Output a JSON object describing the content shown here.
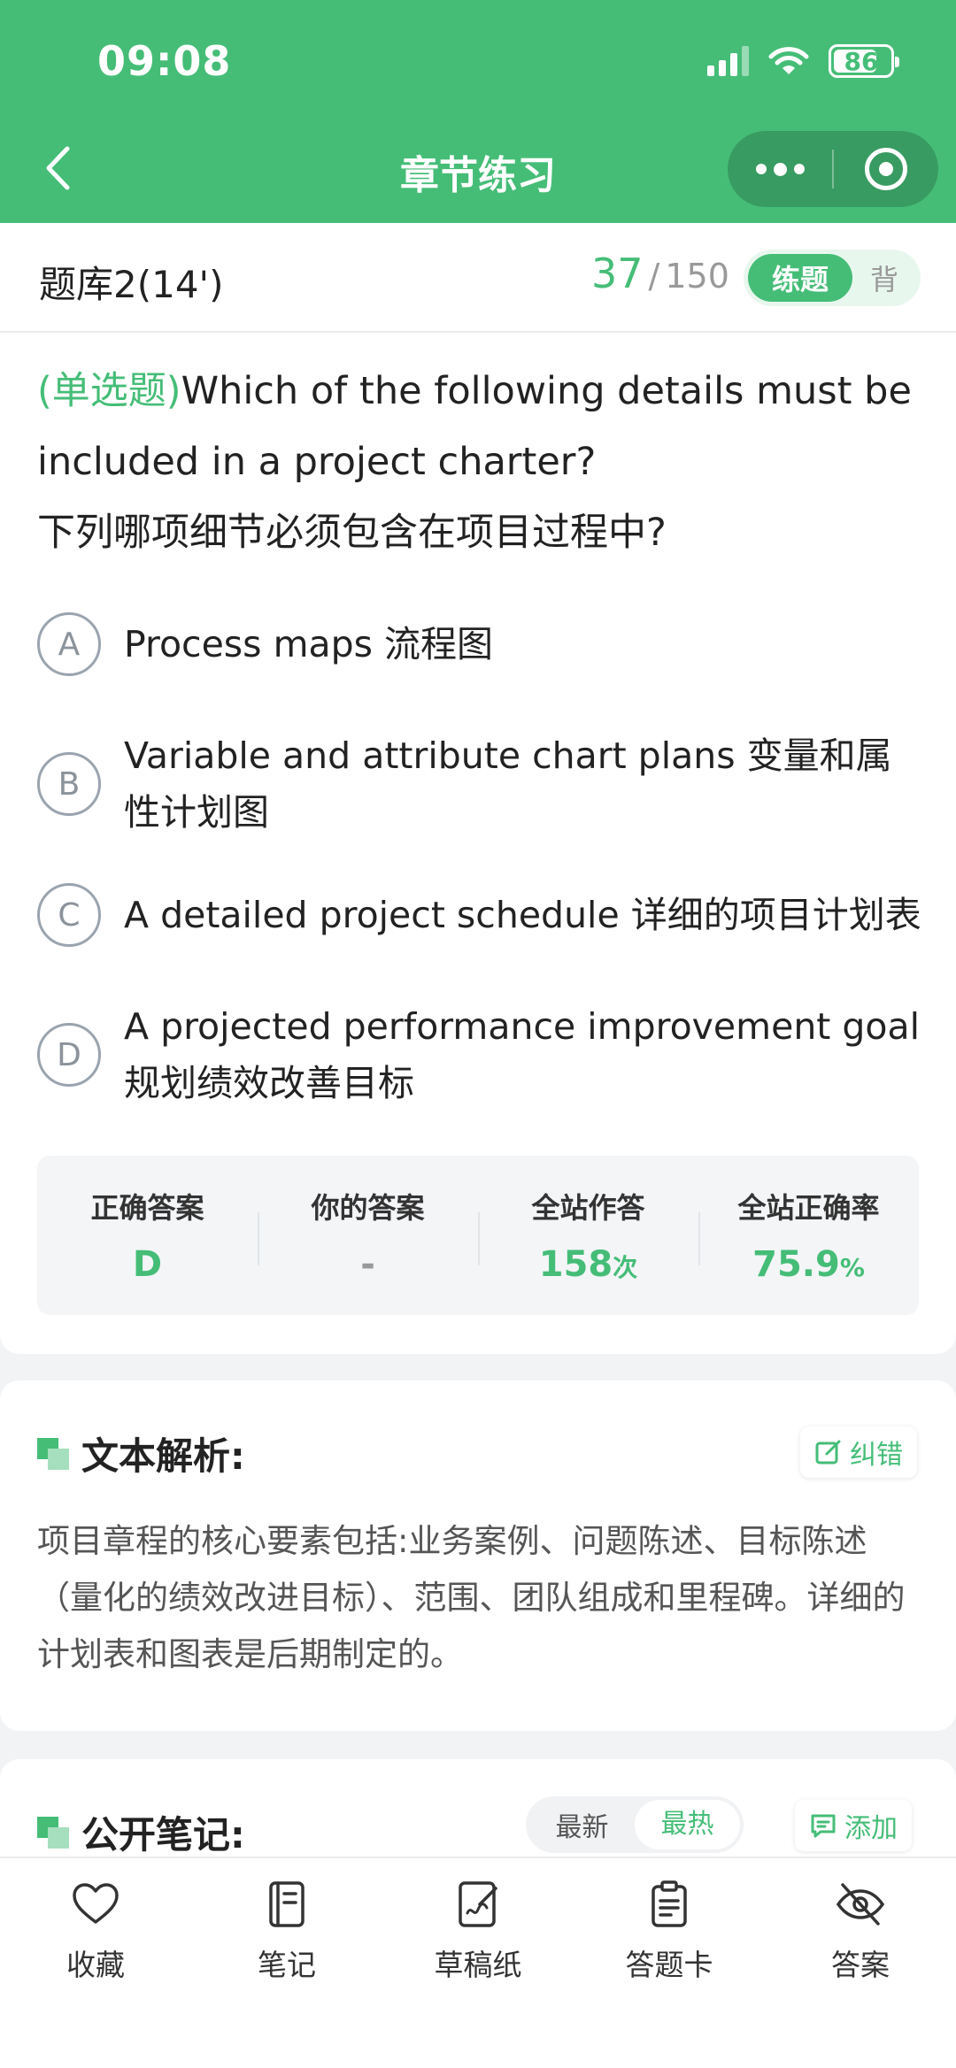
{
  "status_bar": {
    "time": "09:08",
    "battery": "86"
  },
  "nav": {
    "title": "章节练习"
  },
  "bank": {
    "name": "题库2(14')",
    "current": "37",
    "separator": "/",
    "total": "150"
  },
  "mode": {
    "active": "练题",
    "inactive": "背"
  },
  "question": {
    "type": "(单选题)",
    "text_en": "Which of the following details must be included in a project charter?",
    "text_zh": "下列哪项细节必须包含在项目过程中?"
  },
  "options": [
    {
      "letter": "A",
      "text": "Process maps 流程图"
    },
    {
      "letter": "B",
      "text": "Variable and attribute chart plans 变量和属性计划图"
    },
    {
      "letter": "C",
      "text": "A detailed project schedule 详细的项目计划表"
    },
    {
      "letter": "D",
      "text": "A projected performance improvement goal 规划绩效改善目标"
    }
  ],
  "stats": [
    {
      "label": "正确答案",
      "value": "D",
      "unit": ""
    },
    {
      "label": "你的答案",
      "value": "-",
      "unit": ""
    },
    {
      "label": "全站作答",
      "value": "158",
      "unit": "次"
    },
    {
      "label": "全站正确率",
      "value": "75.9",
      "unit": "%"
    }
  ],
  "analysis": {
    "title": "文本解析:",
    "report_label": "纠错",
    "text": "项目章程的核心要素包括:业务案例、问题陈述、目标陈述（量化的绩效改进目标）、范围、团队组成和里程碑。详细的计划表和图表是后期制定的。"
  },
  "notes": {
    "title": "公开笔记:",
    "sort_latest": "最新",
    "sort_hot": "最热",
    "add_label": "添加"
  },
  "tabbar": [
    {
      "label": "收藏",
      "icon": "heart-icon"
    },
    {
      "label": "笔记",
      "icon": "notebook-icon"
    },
    {
      "label": "草稿纸",
      "icon": "draft-icon"
    },
    {
      "label": "答题卡",
      "icon": "answer-card-icon"
    },
    {
      "label": "答案",
      "icon": "eye-off-icon"
    }
  ],
  "colors": {
    "brand": "#45bd77",
    "brand_light": "#a6dfbe"
  }
}
